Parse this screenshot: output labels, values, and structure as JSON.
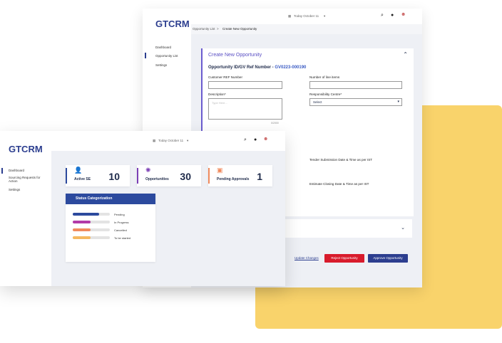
{
  "colors": {
    "accent": "#2c3e8f",
    "yellow": "#f9d36b",
    "reject": "#d81b2c",
    "approve": "#2c3e8f"
  },
  "back": {
    "logo": "GTCRM",
    "nav": [
      "Dashboard",
      "Opportunity List",
      "Settings"
    ],
    "date": "Today October 11",
    "breadcrumb": {
      "parent": "Opportunity List",
      "sep": ">",
      "current": "Create New Opportunity"
    },
    "card_title": "Create New Opportunity",
    "ref": {
      "label": "Opportunity ID/GV Ref Number - ",
      "value": "GV0223-000190"
    },
    "fields": {
      "customer_ref": "Customer REF Number",
      "line_items": "Number of line items",
      "description": "Description*",
      "description_placeholder": "Type Here...",
      "char_count": "0/2000",
      "responsibility": "Responsibility Centre*",
      "select": "Select",
      "tender": "Tender Submission Date & Time as per IST",
      "closing": "Estimate Closing Date & Time as per IST"
    },
    "actions": {
      "update": "Update Changes",
      "reject": "Reject Opportunity",
      "approve": "Approve Opportunity"
    }
  },
  "front": {
    "logo": "GTCRM",
    "nav": [
      "Dashboard",
      "Sourcing Requests for Action",
      "Settings"
    ],
    "date": "Today October 11",
    "stats": [
      {
        "label": "Active SE",
        "value": "10",
        "accent": "#2c4a9e",
        "icon": "user-icon"
      },
      {
        "label": "Opportunities",
        "value": "30",
        "accent": "#7b3fb5",
        "icon": "opportunity-icon"
      },
      {
        "label": "Pending Approvals",
        "value": "1",
        "accent": "#f08a5d",
        "icon": "approval-icon"
      }
    ],
    "status": {
      "title": "Status Categorization",
      "items": [
        {
          "label": "Pending",
          "fill": 0.72,
          "color": "#2c4a9e"
        },
        {
          "label": "In Progress",
          "fill": 0.48,
          "color": "#b23aa8"
        },
        {
          "label": "Cancelled",
          "fill": 0.48,
          "color": "#f08a5d"
        },
        {
          "label": "To be started",
          "fill": 0.48,
          "color": "#f5b860"
        }
      ]
    }
  }
}
